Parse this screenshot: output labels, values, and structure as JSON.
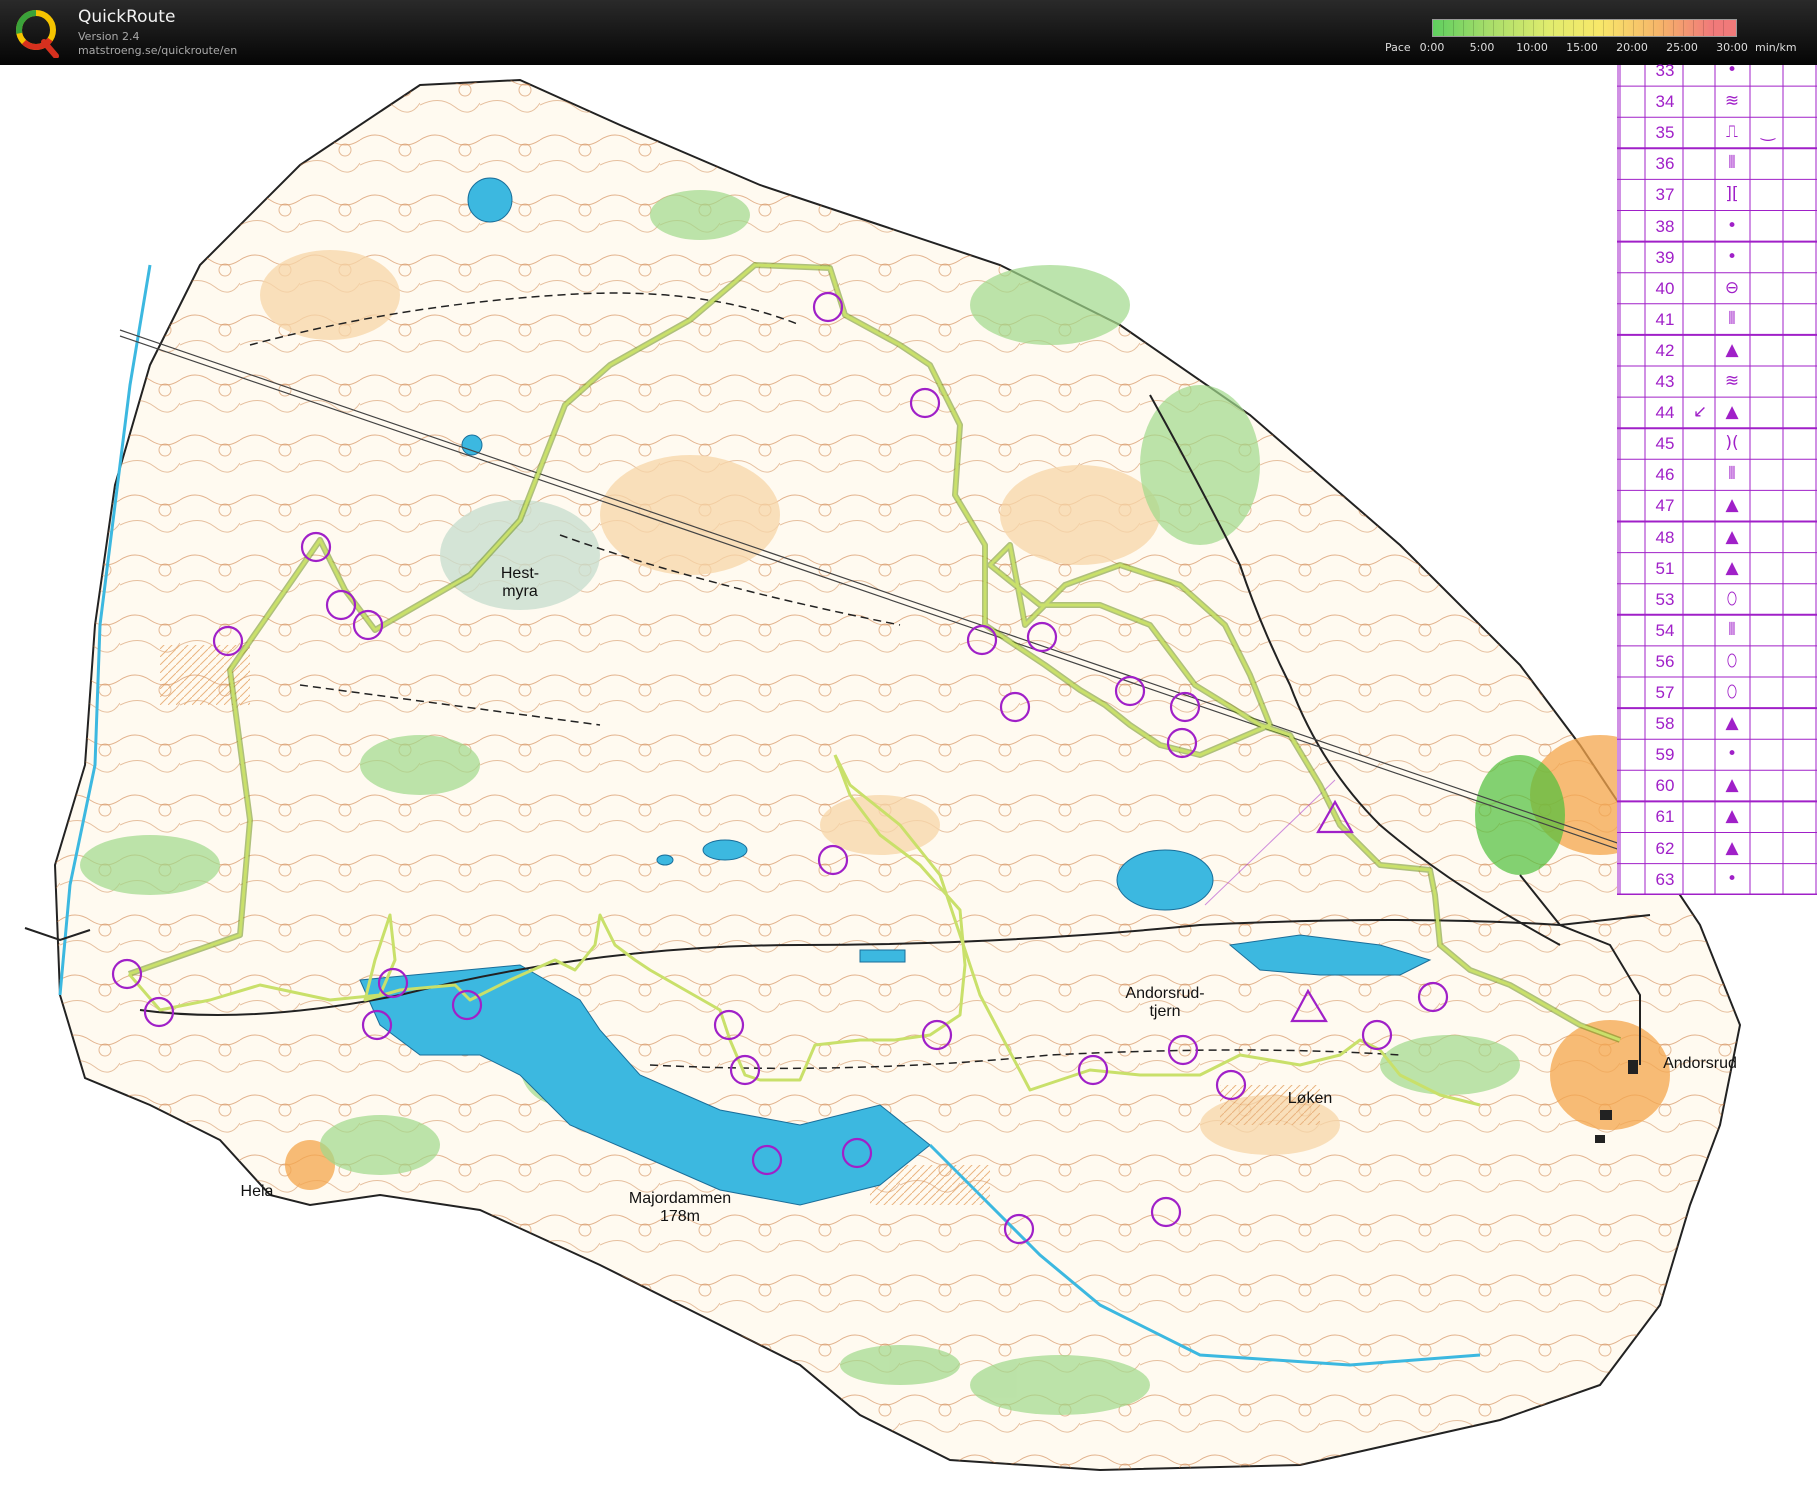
{
  "app": {
    "title": "QuickRoute",
    "version": "Version 2.4",
    "url": "matstroeng.se/quickroute/en"
  },
  "pace_legend": {
    "label": "Pace",
    "ticks": [
      "0:00",
      "5:00",
      "10:00",
      "15:00",
      "20:00",
      "25:00",
      "30:00"
    ],
    "unit": "min/km",
    "colors": [
      "#5fcf5f",
      "#a6dd6a",
      "#e0ec6e",
      "#f8e86a",
      "#f6b46a",
      "#f07a7a"
    ]
  },
  "control_descriptions": [
    {
      "num": "33",
      "symbol": "•",
      "extra": "",
      "extra2": ""
    },
    {
      "num": "34",
      "symbol": "≋",
      "extra": "",
      "extra2": ""
    },
    {
      "num": "35",
      "symbol": "⎍",
      "extra": "",
      "extra2": "‿"
    },
    {
      "num": "36",
      "symbol": "⫴",
      "extra": "",
      "extra2": ""
    },
    {
      "num": "37",
      "symbol": "][",
      "extra": "",
      "extra2": ""
    },
    {
      "num": "38",
      "symbol": "•",
      "extra": "",
      "extra2": ""
    },
    {
      "num": "39",
      "symbol": "•",
      "extra": "",
      "extra2": ""
    },
    {
      "num": "40",
      "symbol": "⊖",
      "extra": "",
      "extra2": ""
    },
    {
      "num": "41",
      "symbol": "⫴",
      "extra": "",
      "extra2": ""
    },
    {
      "num": "42",
      "symbol": "▲",
      "extra": "",
      "extra2": ""
    },
    {
      "num": "43",
      "symbol": "≋",
      "extra": "",
      "extra2": ""
    },
    {
      "num": "44",
      "symbol": "▲",
      "extra": "↙",
      "extra2": ""
    },
    {
      "num": "45",
      "symbol": ")(",
      "extra": "",
      "extra2": ""
    },
    {
      "num": "46",
      "symbol": "⫴",
      "extra": "",
      "extra2": ""
    },
    {
      "num": "47",
      "symbol": "▲",
      "extra": "",
      "extra2": ""
    },
    {
      "num": "48",
      "symbol": "▲",
      "extra": "",
      "extra2": ""
    },
    {
      "num": "51",
      "symbol": "▲",
      "extra": "",
      "extra2": ""
    },
    {
      "num": "53",
      "symbol": "⬯",
      "extra": "",
      "extra2": ""
    },
    {
      "num": "54",
      "symbol": "⫴",
      "extra": "",
      "extra2": ""
    },
    {
      "num": "56",
      "symbol": "⬯",
      "extra": "",
      "extra2": ""
    },
    {
      "num": "57",
      "symbol": "⬯",
      "extra": "",
      "extra2": ""
    },
    {
      "num": "58",
      "symbol": "▲",
      "extra": "",
      "extra2": ""
    },
    {
      "num": "59",
      "symbol": "•",
      "extra": "",
      "extra2": ""
    },
    {
      "num": "60",
      "symbol": "▲",
      "extra": "",
      "extra2": ""
    },
    {
      "num": "61",
      "symbol": "▲",
      "extra": "",
      "extra2": ""
    },
    {
      "num": "62",
      "symbol": "▲",
      "extra": "",
      "extra2": ""
    },
    {
      "num": "63",
      "symbol": "•",
      "extra": "",
      "extra2": ""
    }
  ],
  "map_labels": {
    "hestmyra": "Hest-\nmyra",
    "andorsrudtjern": "Andorsrud-\ntjern",
    "loken": "Løken",
    "andorsrud": "Andorsrud",
    "heia": "Heia",
    "majordammen": "Majordammen\n178m"
  },
  "colors": {
    "route": "#b5d84a",
    "control": "#a020c8",
    "water": "#3cb8e0",
    "forest_green": "#8fd07a",
    "open_land": "#f7c98a",
    "contour": "#c9773a"
  }
}
